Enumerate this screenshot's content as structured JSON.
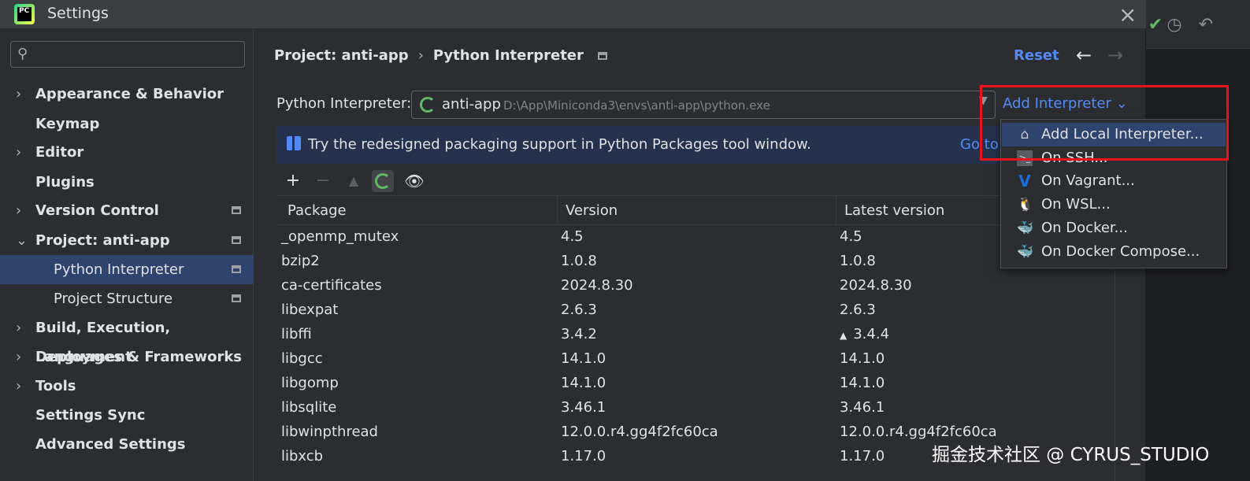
{
  "window": {
    "title": "Settings"
  },
  "sidebar": {
    "search_placeholder": "",
    "items": [
      {
        "label": "Appearance & Behavior",
        "arrow": "›"
      },
      {
        "label": "Keymap"
      },
      {
        "label": "Editor",
        "arrow": "›"
      },
      {
        "label": "Plugins"
      },
      {
        "label": "Version Control",
        "arrow": "›"
      },
      {
        "label": "Project: anti-app",
        "arrow": "⌄"
      },
      {
        "label": "Python Interpreter"
      },
      {
        "label": "Project Structure"
      },
      {
        "label": "Build, Execution, Deployment",
        "arrow": "›"
      },
      {
        "label": "Languages & Frameworks",
        "arrow": "›"
      },
      {
        "label": "Tools",
        "arrow": "›"
      },
      {
        "label": "Settings Sync"
      },
      {
        "label": "Advanced Settings"
      }
    ]
  },
  "header": {
    "breadcrumb_project": "Project: anti-app",
    "breadcrumb_sep": "›",
    "breadcrumb_page": "Python Interpreter",
    "reset_label": "Reset",
    "back_arrow": "←",
    "forward_arrow": "→"
  },
  "interpreter": {
    "label": "Python Interpreter:",
    "name": "anti-app",
    "path": "D:\\App\\Miniconda3\\envs\\anti-app\\python.exe",
    "add_label": "Add Interpreter",
    "add_chevron": "⌄"
  },
  "banner": {
    "text": "Try the redesigned packaging support in Python Packages tool window.",
    "link": "Go to"
  },
  "toolbar": {
    "add": "+",
    "remove": "−",
    "upgrade": "▲",
    "show": "👁"
  },
  "table": {
    "headers": [
      "Package",
      "Version",
      "Latest version"
    ],
    "rows": [
      [
        "_openmp_mutex",
        "4.5",
        "4.5"
      ],
      [
        "bzip2",
        "1.0.8",
        "1.0.8"
      ],
      [
        "ca-certificates",
        "2024.8.30",
        "2024.8.30"
      ],
      [
        "libexpat",
        "2.6.3",
        "2.6.3"
      ],
      [
        "libffi",
        "3.4.2",
        "3.4.4"
      ],
      [
        "libgcc",
        "14.1.0",
        "14.1.0"
      ],
      [
        "libgomp",
        "14.1.0",
        "14.1.0"
      ],
      [
        "libsqlite",
        "3.46.1",
        "3.46.1"
      ],
      [
        "libwinpthread",
        "12.0.0.r4.gg4f2fc60ca",
        "12.0.0.r4.gg4f2fc60ca"
      ],
      [
        "libxcb",
        "1.17.0",
        "1.17.0"
      ]
    ]
  },
  "dropdown": {
    "items": [
      {
        "label": "Add Local Interpreter...",
        "icon": "home-icon"
      },
      {
        "label": "On SSH...",
        "icon": "terminal-icon"
      },
      {
        "label": "On Vagrant...",
        "icon": "vagrant-icon"
      },
      {
        "label": "On WSL...",
        "icon": "linux-icon"
      },
      {
        "label": "On Docker...",
        "icon": "docker-icon"
      },
      {
        "label": "On Docker Compose...",
        "icon": "docker-icon"
      }
    ]
  },
  "watermark": "掘金技术社区 @ CYRUS_STUDIO",
  "colors": {
    "accent": "#548af7",
    "selection": "#2e436e",
    "highlight_box": "#e8131a"
  }
}
